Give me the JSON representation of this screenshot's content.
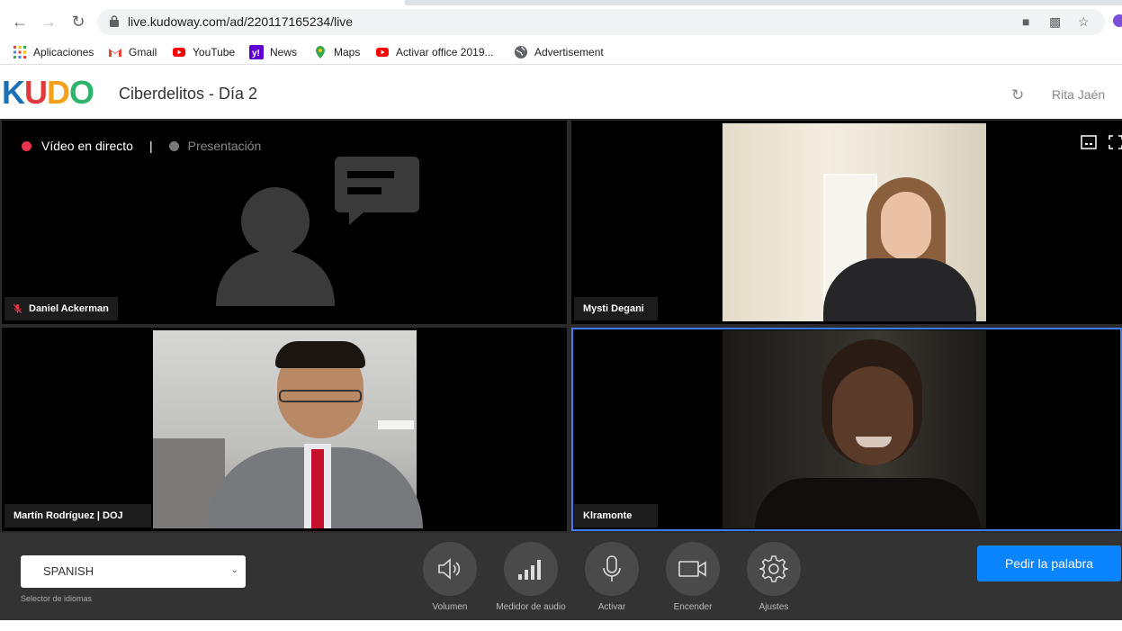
{
  "browser": {
    "url": "live.kudoway.com/ad/220117165234/live",
    "bookmarks": [
      {
        "label": "Aplicaciones",
        "icon": "apps-grid-icon"
      },
      {
        "label": "Gmail",
        "icon": "gmail-icon"
      },
      {
        "label": "YouTube",
        "icon": "youtube-icon"
      },
      {
        "label": "News",
        "icon": "yahoo-icon"
      },
      {
        "label": "Maps",
        "icon": "maps-pin-icon"
      },
      {
        "label": "Activar office 2019...",
        "icon": "youtube-icon"
      },
      {
        "label": "Advertisement",
        "icon": "globe-icon"
      }
    ]
  },
  "app": {
    "logo": "KUDO",
    "logo_colors": [
      "#1a6fb5",
      "#e03a3e",
      "#f6a01a",
      "#2eb36b"
    ],
    "meeting_title": "Ciberdelitos - Día 2",
    "user_name": "Rita Jaén"
  },
  "stage": {
    "mode_live": "Vídeo en directo",
    "mode_separator": "|",
    "mode_presentation": "Presentación",
    "live_color": "#e8344e",
    "participants": [
      {
        "name": "Daniel Ackerman",
        "muted": true,
        "video": false
      },
      {
        "name": "Mysti Degani",
        "video": true
      },
      {
        "name": "Martín Rodríguez | DOJ",
        "video": true
      },
      {
        "name": "Klramonte",
        "video": true,
        "active_speaker": true
      }
    ],
    "active_border_color": "#3d7bf5"
  },
  "toolbar": {
    "language_value": "SPANISH",
    "language_label": "Selector de idiomas",
    "controls": [
      {
        "label": "Volumen",
        "icon": "speaker-icon"
      },
      {
        "label": "Medidor de audio",
        "icon": "audio-meter-icon"
      },
      {
        "label": "Activar",
        "icon": "microphone-icon"
      },
      {
        "label": "Encender",
        "icon": "camera-icon"
      },
      {
        "label": "Ajustes",
        "icon": "gear-icon"
      }
    ],
    "request_floor": "Pedir la palabra"
  }
}
